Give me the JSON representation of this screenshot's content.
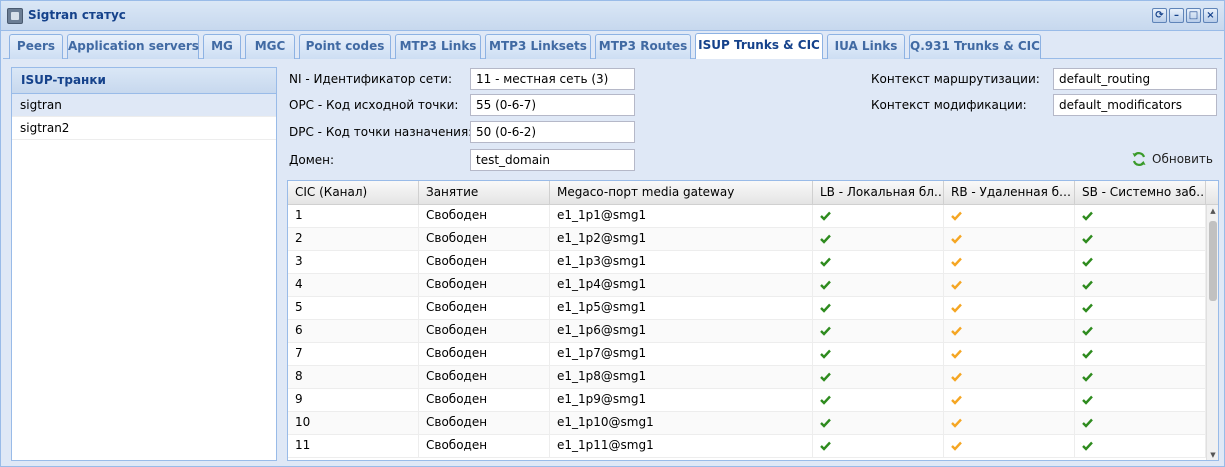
{
  "window": {
    "title": "Sigtran статус"
  },
  "tabs": [
    {
      "label": "Peers",
      "active": false
    },
    {
      "label": "Application servers",
      "active": false
    },
    {
      "label": "MG",
      "active": false
    },
    {
      "label": "MGC",
      "active": false
    },
    {
      "label": "Point codes",
      "active": false
    },
    {
      "label": "MTP3 Links",
      "active": false
    },
    {
      "label": "MTP3 Linksets",
      "active": false
    },
    {
      "label": "MTP3 Routes",
      "active": false
    },
    {
      "label": "ISUP Trunks & CIC",
      "active": true
    },
    {
      "label": "IUA Links",
      "active": false
    },
    {
      "label": "Q.931 Trunks & CIC",
      "active": false
    }
  ],
  "trunks_panel": {
    "title": "ISUP-транки",
    "items": [
      "sigtran",
      "sigtran2"
    ],
    "selected_index": 0
  },
  "form": {
    "ni_label": "NI - Идентификатор сети:",
    "ni_value": "11 - местная сеть (3)",
    "opc_label": "OPC - Код исходной точки:",
    "opc_value": "55 (0-6-7)",
    "dpc_label": "DPC - Код точки назначения:",
    "dpc_value": "50 (0-6-2)",
    "domain_label": "Домен:",
    "domain_value": "test_domain",
    "routing_label": "Контекст маршрутизации:",
    "routing_value": "default_routing",
    "modif_label": "Контекст модификации:",
    "modif_value": "default_modificators",
    "refresh_label": "Обновить"
  },
  "grid": {
    "columns": [
      "CIC (Канал)",
      "Занятие",
      "Megaco-порт media gateway",
      "LB - Локальная бл…",
      "RB - Удаленная б…",
      "SB - Системно заб…"
    ],
    "rows": [
      {
        "cic": "1",
        "state": "Свободен",
        "port": "e1_1p1@smg1",
        "lb": "ok",
        "rb": "warn",
        "sb": "ok"
      },
      {
        "cic": "2",
        "state": "Свободен",
        "port": "e1_1p2@smg1",
        "lb": "ok",
        "rb": "warn",
        "sb": "ok"
      },
      {
        "cic": "3",
        "state": "Свободен",
        "port": "e1_1p3@smg1",
        "lb": "ok",
        "rb": "warn",
        "sb": "ok"
      },
      {
        "cic": "4",
        "state": "Свободен",
        "port": "e1_1p4@smg1",
        "lb": "ok",
        "rb": "warn",
        "sb": "ok"
      },
      {
        "cic": "5",
        "state": "Свободен",
        "port": "e1_1p5@smg1",
        "lb": "ok",
        "rb": "warn",
        "sb": "ok"
      },
      {
        "cic": "6",
        "state": "Свободен",
        "port": "e1_1p6@smg1",
        "lb": "ok",
        "rb": "warn",
        "sb": "ok"
      },
      {
        "cic": "7",
        "state": "Свободен",
        "port": "e1_1p7@smg1",
        "lb": "ok",
        "rb": "warn",
        "sb": "ok"
      },
      {
        "cic": "8",
        "state": "Свободен",
        "port": "e1_1p8@smg1",
        "lb": "ok",
        "rb": "warn",
        "sb": "ok"
      },
      {
        "cic": "9",
        "state": "Свободен",
        "port": "e1_1p9@smg1",
        "lb": "ok",
        "rb": "warn",
        "sb": "ok"
      },
      {
        "cic": "10",
        "state": "Свободен",
        "port": "e1_1p10@smg1",
        "lb": "ok",
        "rb": "warn",
        "sb": "ok"
      },
      {
        "cic": "11",
        "state": "Свободен",
        "port": "e1_1p11@smg1",
        "lb": "ok",
        "rb": "warn",
        "sb": "ok"
      }
    ]
  },
  "colors": {
    "ok": "#2e8b1e",
    "warn": "#f5a623",
    "accent": "#15428b"
  }
}
